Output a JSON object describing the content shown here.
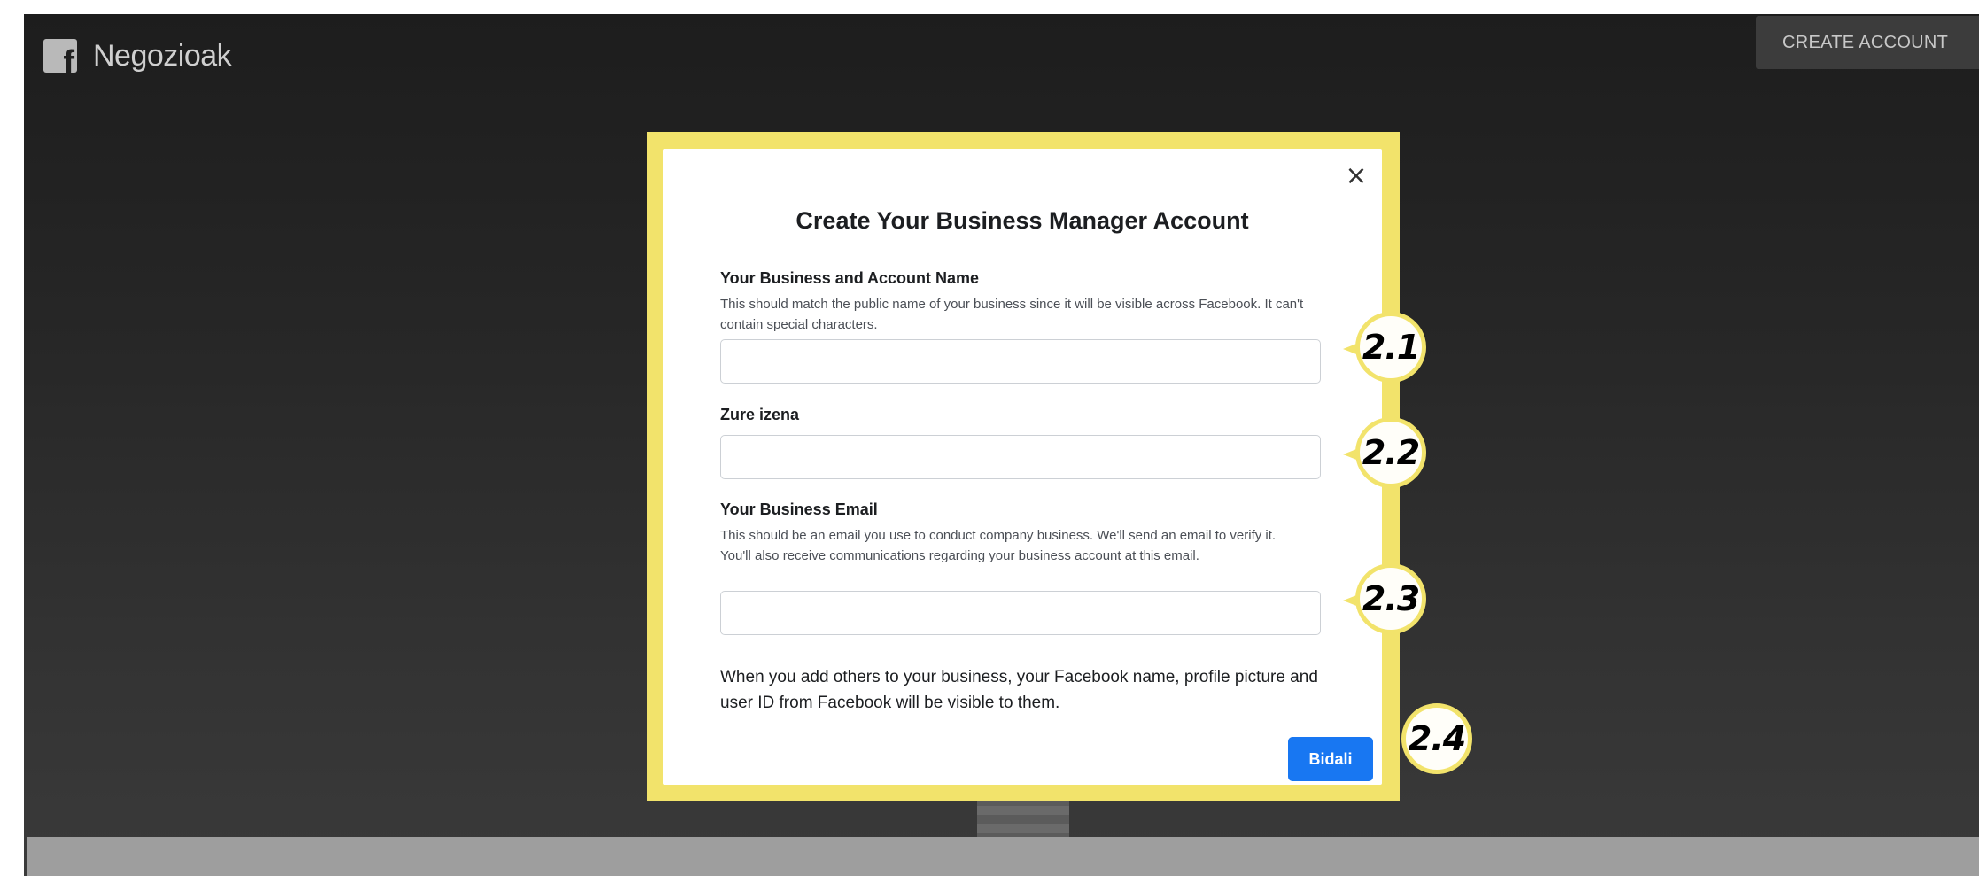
{
  "header": {
    "brand": "Negozioak",
    "create_account": "CREATE ACCOUNT"
  },
  "modal": {
    "title": "Create Your Business Manager Account",
    "close_symbol": "×",
    "business_name": {
      "label": "Your Business and Account Name",
      "help": "This should match the public name of your business since it will be visible across Facebook. It can't contain special characters.",
      "value": ""
    },
    "your_name": {
      "label": "Zure izena",
      "value": ""
    },
    "business_email": {
      "label": "Your Business Email",
      "help": "This should be an email you use to conduct company business. We'll send an email to verify it. You'll also receive communications regarding your business account at this email.",
      "value": ""
    },
    "notice": "When you add others to your business, your Facebook name, profile picture and user ID from Facebook will be visible to them.",
    "submit": "Bidali"
  },
  "annotations": {
    "step_1": "2.1",
    "step_2": "2.2",
    "step_3": "2.3",
    "step_4": "2.4"
  },
  "colors": {
    "highlight": "#f2e36b",
    "primary_button": "#1877f2"
  }
}
